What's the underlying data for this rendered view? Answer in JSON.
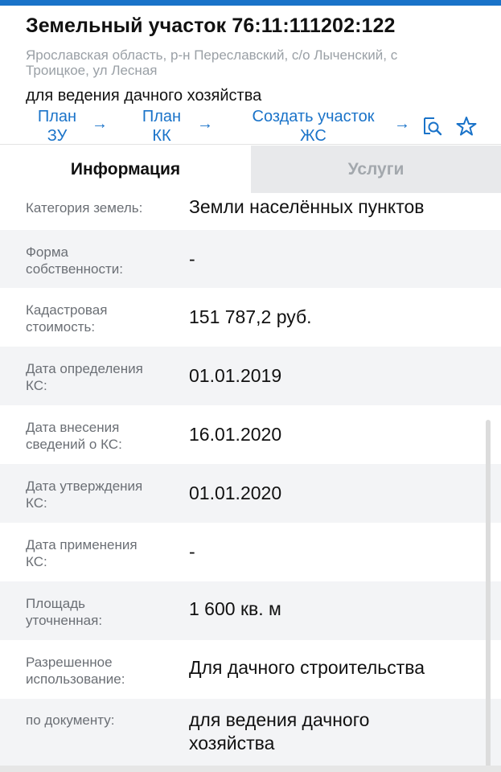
{
  "header": {
    "title": "Земельный участок 76:11:111202:122",
    "address_line1": "Ярославская область, р-н Переславский, с/о Лыченский, с",
    "address_line2": "Троицкое, ул Лесная",
    "purpose": "для ведения дачного хозяйства"
  },
  "nav": {
    "plan_zu_line1": "План",
    "plan_zu_line2": "ЗУ",
    "plan_kk_line1": "План",
    "plan_kk_line2": "КК",
    "create_line1": "Создать участок",
    "create_line2": "ЖС",
    "arrow": "→"
  },
  "icons": {
    "search": "search-document-icon",
    "favorite": "star-icon"
  },
  "colors": {
    "accent": "#1a73c9",
    "label": "#6b6f75",
    "row_shade": "#f3f4f6",
    "tab_inactive_bg": "#e8e9eb"
  },
  "tabs": {
    "info": "Информация",
    "services": "Услуги"
  },
  "rows": [
    {
      "label1": "Категория земель:",
      "label2": "",
      "value1": "Земли населённых пунктов",
      "value2": ""
    },
    {
      "label1": "Форма",
      "label2": "собственности:",
      "value1": "-",
      "value2": ""
    },
    {
      "label1": "Кадастровая",
      "label2": "стоимость:",
      "value1": "151 787,2 руб.",
      "value2": ""
    },
    {
      "label1": "Дата определения",
      "label2": "КС:",
      "value1": "01.01.2019",
      "value2": ""
    },
    {
      "label1": "Дата внесения",
      "label2": "сведений о КС:",
      "value1": "16.01.2020",
      "value2": ""
    },
    {
      "label1": "Дата утверждения",
      "label2": "КС:",
      "value1": "01.01.2020",
      "value2": ""
    },
    {
      "label1": "Дата применения",
      "label2": "КС:",
      "value1": "-",
      "value2": ""
    },
    {
      "label1": "Площадь",
      "label2": "уточненная:",
      "value1": "1 600 кв. м",
      "value2": ""
    },
    {
      "label1": "Разрешенное",
      "label2": "использование:",
      "value1": "Для дачного строительства",
      "value2": ""
    },
    {
      "label1": "по документу:",
      "label2": "",
      "value1": "для ведения дачного",
      "value2": "хозяйства"
    }
  ]
}
